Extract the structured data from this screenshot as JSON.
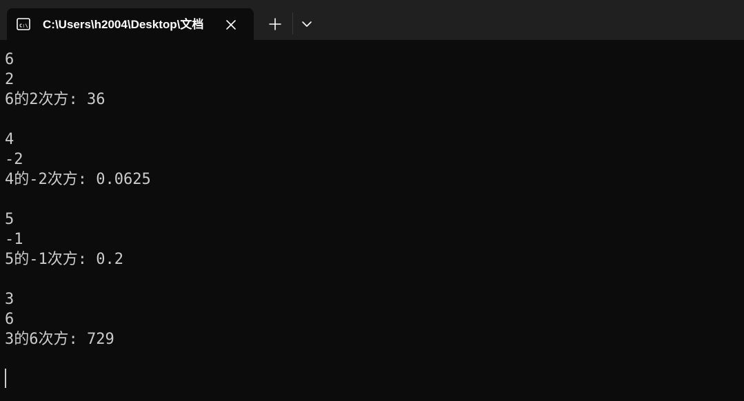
{
  "window": {
    "tab_title": "C:\\Users\\h2004\\Desktop\\文档",
    "tab_icon": "cmd-icon",
    "new_tab_icon": "plus-icon",
    "dropdown_icon": "chevron-down-icon",
    "close_icon": "close-icon"
  },
  "terminal": {
    "lines": [
      "6",
      "2",
      "6的2次方: 36",
      "",
      "4",
      "-2",
      "4的-2次方: 0.0625",
      "",
      "5",
      "-1",
      "5的-1次方: 0.2",
      "",
      "3",
      "6",
      "3的6次方: 729"
    ]
  },
  "colors": {
    "background": "#0c0c0c",
    "titlebar": "#202020",
    "text": "#cccccc"
  }
}
